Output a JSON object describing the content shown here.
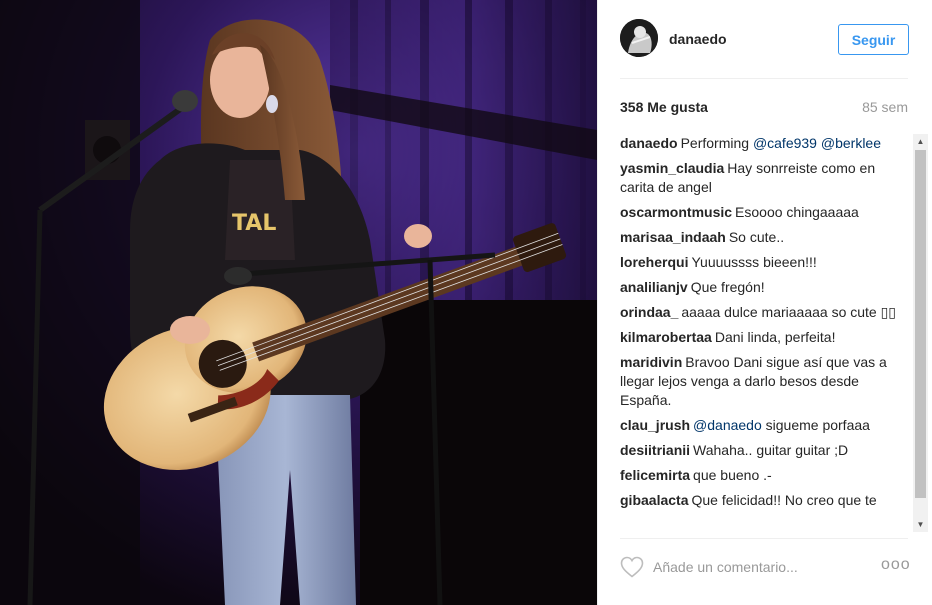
{
  "post": {
    "username": "danaedo",
    "follow_label": "Seguir",
    "likes": "358 Me gusta",
    "age": "85 sem",
    "comments": [
      {
        "author": "danaedo",
        "parts": [
          {
            "t": "Performing "
          },
          {
            "t": "@cafe939",
            "m": true
          },
          {
            "t": " "
          },
          {
            "t": "@berklee",
            "m": true
          }
        ]
      },
      {
        "author": "yasmin_claudia",
        "parts": [
          {
            "t": "Hay sonrreiste como en carita de angel"
          }
        ]
      },
      {
        "author": "oscarmontmusic",
        "parts": [
          {
            "t": "Esoooo chingaaaaa"
          }
        ]
      },
      {
        "author": "marisaa_indaah",
        "parts": [
          {
            "t": "So cute.."
          }
        ]
      },
      {
        "author": "loreherqui",
        "parts": [
          {
            "t": "Yuuuussss bieeen!!!"
          }
        ]
      },
      {
        "author": "analilianjv",
        "parts": [
          {
            "t": "Que fregón!"
          }
        ]
      },
      {
        "author": "orindaa_",
        "parts": [
          {
            "t": "aaaaa dulce mariaaaaa so cute ▯▯"
          }
        ]
      },
      {
        "author": "kilmarobertaa",
        "parts": [
          {
            "t": "Dani linda, perfeita!"
          }
        ]
      },
      {
        "author": "maridivin",
        "parts": [
          {
            "t": "Bravoo Dani sigue así que vas a llegar lejos venga a darlo besos desde España."
          }
        ]
      },
      {
        "author": "clau_jrush",
        "parts": [
          {
            "t": "@danaedo",
            "m": true
          },
          {
            "t": " sigueme porfaaa"
          }
        ]
      },
      {
        "author": "desiitrianii",
        "parts": [
          {
            "t": "Wahaha.. guitar guitar ;D"
          }
        ]
      },
      {
        "author": "felicemirta",
        "parts": [
          {
            "t": "que bueno .-"
          }
        ]
      },
      {
        "author": "gibaalacta",
        "parts": [
          {
            "t": "Que felicidad!! No creo que te"
          }
        ]
      }
    ],
    "comment_placeholder": "Añade un comentario...",
    "more_label": "ooo"
  },
  "icons": {
    "heart": "heart-outline-icon",
    "scroll_up": "scroll-up-arrow-icon",
    "scroll_down": "scroll-down-arrow-icon"
  },
  "colors": {
    "follow_blue": "#3897f0",
    "mention": "#003569",
    "muted": "#999999",
    "stage_purple": "#4b2a8a"
  }
}
